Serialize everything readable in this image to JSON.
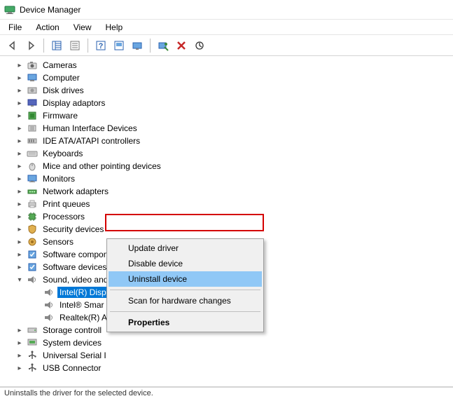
{
  "title": "Device Manager",
  "menu": {
    "items": [
      "File",
      "Action",
      "View",
      "Help"
    ]
  },
  "toolbar_icons": [
    "back",
    "forward",
    "show-tree",
    "properties",
    "help",
    "update-driver",
    "scan-hardware",
    "uninstall",
    "delete",
    "refresh"
  ],
  "tree": {
    "categories": [
      {
        "label": "Cameras",
        "icon": "camera"
      },
      {
        "label": "Computer",
        "icon": "computer"
      },
      {
        "label": "Disk drives",
        "icon": "disk"
      },
      {
        "label": "Display adaptors",
        "icon": "display"
      },
      {
        "label": "Firmware",
        "icon": "firmware"
      },
      {
        "label": "Human Interface Devices",
        "icon": "hid"
      },
      {
        "label": "IDE ATA/ATAPI controllers",
        "icon": "ide"
      },
      {
        "label": "Keyboards",
        "icon": "keyboard"
      },
      {
        "label": "Mice and other pointing devices",
        "icon": "mouse"
      },
      {
        "label": "Monitors",
        "icon": "monitor"
      },
      {
        "label": "Network adapters",
        "icon": "network"
      },
      {
        "label": "Print queues",
        "icon": "printer"
      },
      {
        "label": "Processors",
        "icon": "cpu"
      },
      {
        "label": "Security devices",
        "icon": "security"
      },
      {
        "label": "Sensors",
        "icon": "sensor"
      },
      {
        "label": "Software components",
        "icon": "software"
      },
      {
        "label": "Software devices",
        "icon": "software"
      },
      {
        "label": "Sound, video and game controllers",
        "icon": "audio",
        "expanded": true,
        "children": [
          {
            "label": "Intel(R) Display Audio",
            "icon": "audio",
            "selected": true
          },
          {
            "label": "Intel® Smar",
            "icon": "audio"
          },
          {
            "label": "Realtek(R) A",
            "icon": "audio"
          }
        ]
      },
      {
        "label": "Storage controll",
        "icon": "storage"
      },
      {
        "label": "System devices",
        "icon": "system"
      },
      {
        "label": "Universal Serial I",
        "icon": "usb"
      },
      {
        "label": "USB Connector",
        "icon": "usb"
      }
    ]
  },
  "context_menu": {
    "items": [
      {
        "label": "Update driver"
      },
      {
        "label": "Disable device"
      },
      {
        "label": "Uninstall device",
        "highlight": true
      },
      {
        "sep": true
      },
      {
        "label": "Scan for hardware changes"
      },
      {
        "sep": true
      },
      {
        "label": "Properties",
        "bold": true
      }
    ]
  },
  "status": "Uninstalls the driver for the selected device."
}
